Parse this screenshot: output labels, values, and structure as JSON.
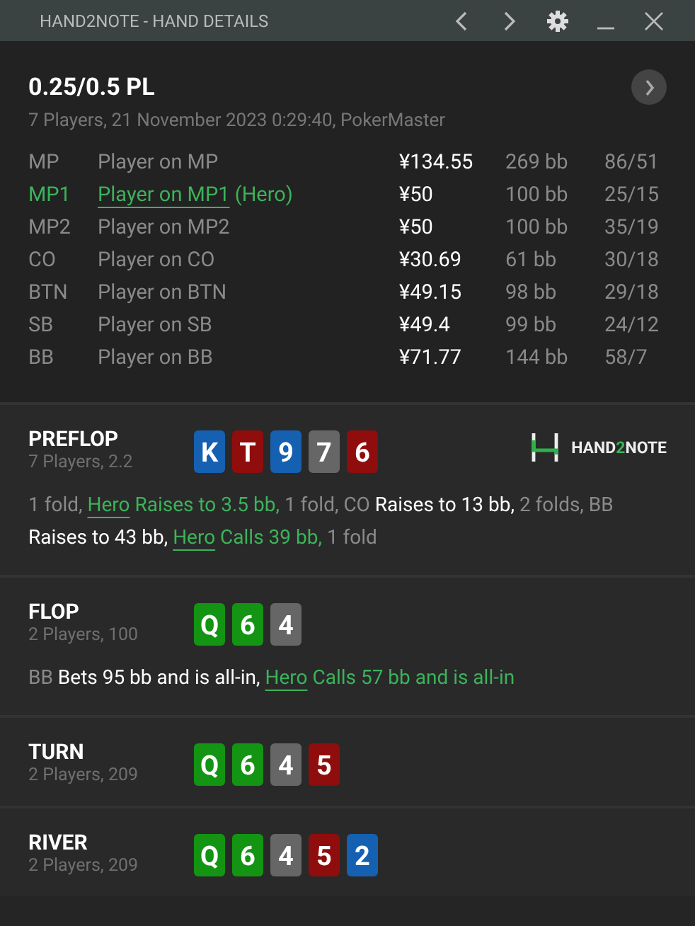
{
  "window": {
    "title": "HAND2NOTE - HAND DETAILS"
  },
  "hand": {
    "game": "0.25/0.5 PL",
    "info": "7 Players, 21 November 2023 0:29:40, PokerMaster"
  },
  "players": [
    {
      "position": "MP",
      "name": "Player on MP",
      "hero": false,
      "stack": "¥134.55",
      "bb": "269 bb",
      "stats": "86/51"
    },
    {
      "position": "MP1",
      "name": "Player on MP1",
      "hero": true,
      "hero_tag": "(Hero)",
      "stack": "¥50",
      "bb": "100 bb",
      "stats": "25/15"
    },
    {
      "position": "MP2",
      "name": "Player on MP2",
      "hero": false,
      "stack": "¥50",
      "bb": "100 bb",
      "stats": "35/19"
    },
    {
      "position": "CO",
      "name": "Player on CO",
      "hero": false,
      "stack": "¥30.69",
      "bb": "61 bb",
      "stats": "30/18"
    },
    {
      "position": "BTN",
      "name": "Player on BTN",
      "hero": false,
      "stack": "¥49.15",
      "bb": "98 bb",
      "stats": "29/18"
    },
    {
      "position": "SB",
      "name": "Player on SB",
      "hero": false,
      "stack": "¥49.4",
      "bb": "99 bb",
      "stats": "24/12"
    },
    {
      "position": "BB",
      "name": "Player on BB",
      "hero": false,
      "stack": "¥71.77",
      "bb": "144 bb",
      "stats": "58/7"
    }
  ],
  "streets": [
    {
      "name": "PREFLOP",
      "info": "7 Players, 2.2",
      "logo": {
        "text_a": "HAND",
        "text_b": "2",
        "text_c": "NOTE"
      },
      "cards": [
        {
          "rank": "K",
          "color": "#1560b0"
        },
        {
          "rank": "T",
          "color": "#8f0d0d"
        },
        {
          "rank": "9",
          "color": "#1560b0"
        },
        {
          "rank": "7",
          "color": "#666666"
        },
        {
          "rank": "6",
          "color": "#8f0d0d"
        }
      ],
      "actions": [
        {
          "text": "1 fold, ",
          "kind": "muted"
        },
        {
          "text": "Hero",
          "kind": "hero_name"
        },
        {
          "text": " Raises to 3.5 bb, ",
          "kind": "hero"
        },
        {
          "text": "1 fold, CO ",
          "kind": "muted"
        },
        {
          "text": "Raises to 13 bb, ",
          "kind": "bright"
        },
        {
          "text": "2 folds, BB ",
          "kind": "muted"
        },
        {
          "text": "Raises to 43 bb, ",
          "kind": "bright"
        },
        {
          "text": "Hero",
          "kind": "hero_name"
        },
        {
          "text": " Calls 39 bb, ",
          "kind": "hero"
        },
        {
          "text": "1 fold",
          "kind": "muted"
        }
      ]
    },
    {
      "name": "FLOP",
      "info": "2 Players, 100",
      "cards": [
        {
          "rank": "Q",
          "color": "#139413"
        },
        {
          "rank": "6",
          "color": "#139413"
        },
        {
          "rank": "4",
          "color": "#666666"
        }
      ],
      "actions": [
        {
          "text": "BB ",
          "kind": "muted"
        },
        {
          "text": "Bets 95 bb and is all-in, ",
          "kind": "bright"
        },
        {
          "text": "Hero",
          "kind": "hero_name"
        },
        {
          "text": " Calls 57 bb and is all-in",
          "kind": "hero"
        }
      ]
    },
    {
      "name": "TURN",
      "info": "2 Players, 209",
      "cards": [
        {
          "rank": "Q",
          "color": "#139413"
        },
        {
          "rank": "6",
          "color": "#139413"
        },
        {
          "rank": "4",
          "color": "#666666"
        },
        {
          "rank": "5",
          "color": "#8f0d0d"
        }
      ]
    },
    {
      "name": "RIVER",
      "info": "2 Players, 209",
      "cards": [
        {
          "rank": "Q",
          "color": "#139413"
        },
        {
          "rank": "6",
          "color": "#139413"
        },
        {
          "rank": "4",
          "color": "#666666"
        },
        {
          "rank": "5",
          "color": "#8f0d0d"
        },
        {
          "rank": "2",
          "color": "#1560b0"
        }
      ]
    }
  ]
}
